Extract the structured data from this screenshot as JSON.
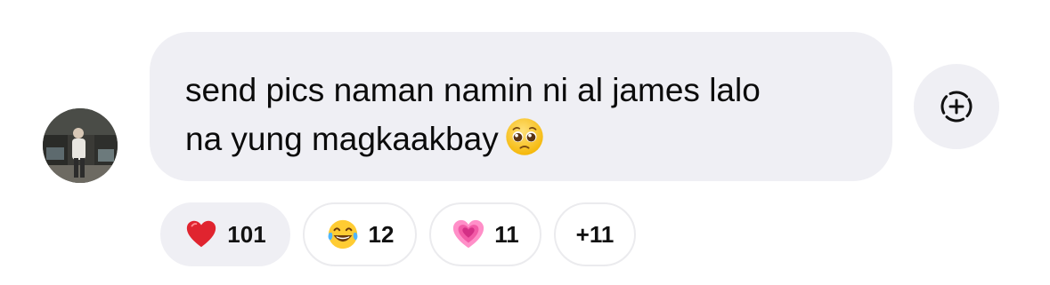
{
  "comment": {
    "avatar_icon": "user-avatar-photo",
    "line1": "send pics naman namin ni al james lalo",
    "line2": "na yung magkaakbay",
    "inline_emoji": "pleading-face-icon",
    "bubble_color": "#efeff4"
  },
  "add_reaction": {
    "icon": "add-reaction-icon"
  },
  "reactions": [
    {
      "icon": "red-heart-icon",
      "count": "101",
      "selected": true
    },
    {
      "icon": "tears-of-joy-icon",
      "count": "12",
      "selected": false
    },
    {
      "icon": "growing-heart-icon",
      "count": "11",
      "selected": false
    },
    {
      "label": "+11",
      "selected": false
    }
  ]
}
